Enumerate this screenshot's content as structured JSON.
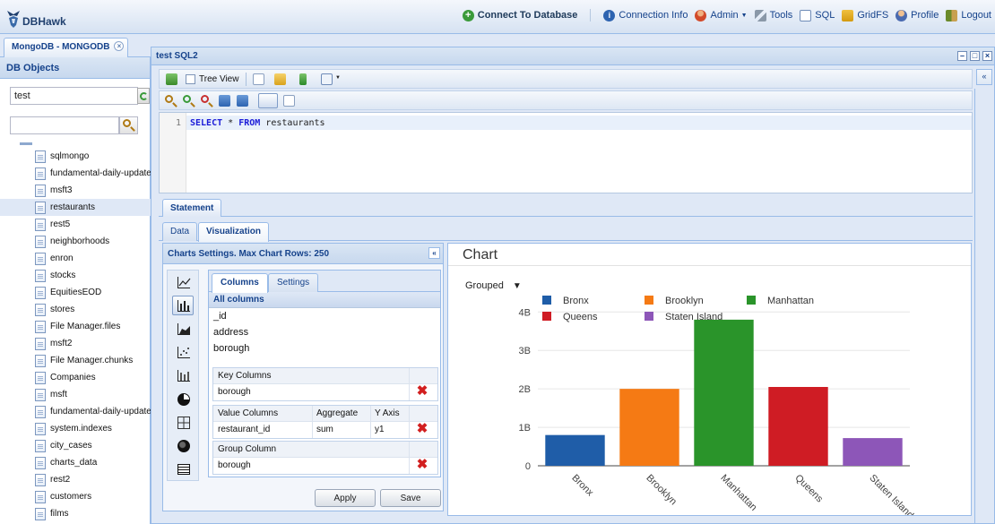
{
  "app": {
    "name": "DBHawk"
  },
  "topnav": {
    "connect": "Connect To Database",
    "connection_info": "Connection Info",
    "admin": "Admin",
    "tools": "Tools",
    "sql": "SQL",
    "gridfs": "GridFS",
    "profile": "Profile",
    "logout": "Logout"
  },
  "left": {
    "tab": "MongoDB - MONGODB",
    "header": "DB Objects",
    "db_value": "test",
    "filter_value": "",
    "items": [
      "sqlmongo",
      "fundamental-daily-update",
      "msft3",
      "restaurants",
      "rest5",
      "neighborhoods",
      "enron",
      "stocks",
      "EquitiesEOD",
      "stores",
      "File Manager.files",
      "msft2",
      "File Manager.chunks",
      "Companies",
      "msft",
      "fundamental-daily-update",
      "system.indexes",
      "city_cases",
      "charts_data",
      "rest2",
      "customers",
      "films"
    ],
    "selected_index": 3
  },
  "window": {
    "title": "test SQL2",
    "tree_view": "Tree View",
    "line_number": "1",
    "sql": {
      "kw1": "SELECT",
      "star": "*",
      "kw2": "FROM",
      "table": "restaurants"
    }
  },
  "tabs": {
    "statement": "Statement",
    "data": "Data",
    "visualization": "Visualization"
  },
  "settings": {
    "header": "Charts Settings. Max Chart Rows: 250",
    "tab_columns": "Columns",
    "tab_settings": "Settings",
    "all_columns_label": "All columns",
    "all_columns": [
      "_id",
      "address",
      "borough"
    ],
    "key_header": "Key Columns",
    "key_value": "borough",
    "value_headers": [
      "Value Columns",
      "Aggregate",
      "Y Axis"
    ],
    "value_row": [
      "restaurant_id",
      "sum",
      "y1"
    ],
    "group_header": "Group Column",
    "group_value": "borough",
    "apply": "Apply",
    "save": "Save"
  },
  "chart": {
    "title": "Chart",
    "mode": "Grouped",
    "mode_arrow": "▼"
  },
  "chart_data": {
    "type": "bar",
    "title": "",
    "categories": [
      "Bronx",
      "Brooklyn",
      "Manhattan",
      "Queens",
      "Staten Island"
    ],
    "values": [
      0.8,
      2.0,
      3.8,
      2.05,
      0.72
    ],
    "colors": [
      "#1f5da8",
      "#f57a14",
      "#2a942a",
      "#cf1c24",
      "#8d56b8"
    ],
    "yticks": [
      "0",
      "1B",
      "2B",
      "3B",
      "4B"
    ],
    "ytick_values": [
      0,
      1,
      2,
      3,
      4
    ],
    "ylim": [
      0,
      4.1
    ],
    "legend": [
      "Bronx",
      "Brooklyn",
      "Manhattan",
      "Queens",
      "Staten Island"
    ],
    "legend_placement": "top",
    "grid": true
  }
}
